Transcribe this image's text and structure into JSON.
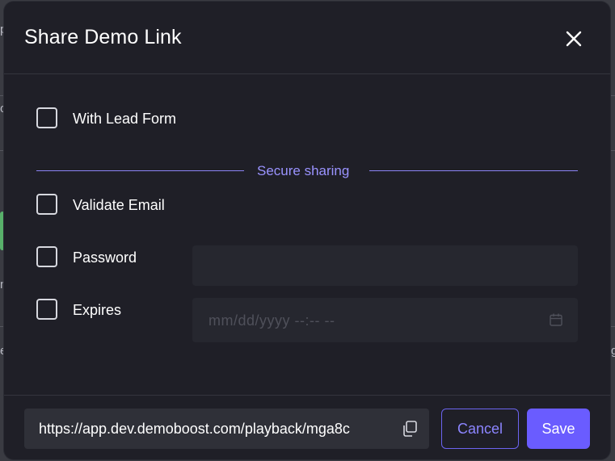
{
  "dialog": {
    "title": "Share Demo Link"
  },
  "options": {
    "lead_form_label": "With Lead Form",
    "section_label": "Secure sharing",
    "validate_email_label": "Validate Email",
    "password_label": "Password",
    "expires_label": "Expires",
    "expires_placeholder": "mm/dd/yyyy --:-- --"
  },
  "footer": {
    "share_url": "https://app.dev.demoboost.com/playback/mga8c",
    "cancel_label": "Cancel",
    "save_label": "Save"
  },
  "background": {
    "frag_1": "p",
    "frag_2": "o",
    "frag_3": "n",
    "frag_4": "e",
    "frag_5": "g"
  },
  "colors": {
    "modal_bg": "#1f1f27",
    "accent": "#6a5cff",
    "accent_text": "#9a93ff"
  },
  "icons": [
    "close-icon",
    "calendar-icon",
    "copy-icon"
  ]
}
